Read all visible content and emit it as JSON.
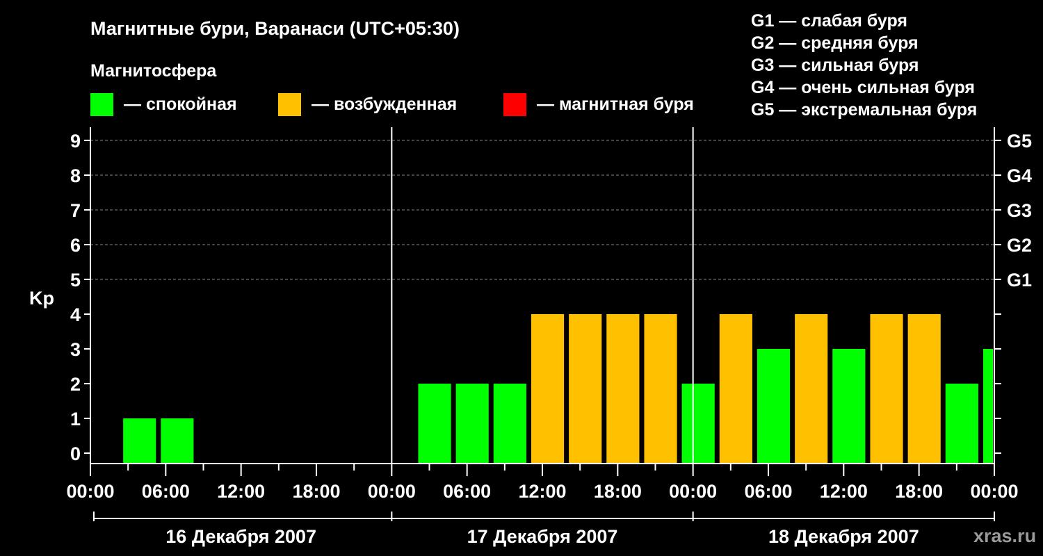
{
  "chart_data": {
    "type": "bar",
    "title": "Магнитные бури, Варанаси (UTC+05:30)",
    "subtitle": "Магнитосфера",
    "ylabel": "Kp",
    "ylim": [
      0,
      9
    ],
    "y_ticks": [
      "0",
      "1",
      "2",
      "3",
      "4",
      "5",
      "6",
      "7",
      "8",
      "9"
    ],
    "right_ticks": [
      {
        "value": 5,
        "label": "G1"
      },
      {
        "value": 6,
        "label": "G2"
      },
      {
        "value": 7,
        "label": "G3"
      },
      {
        "value": 8,
        "label": "G4"
      },
      {
        "value": 9,
        "label": "G5"
      }
    ],
    "x_ticks": [
      "00:00",
      "06:00",
      "12:00",
      "18:00",
      "00:00",
      "06:00",
      "12:00",
      "18:00",
      "00:00",
      "06:00",
      "12:00",
      "18:00",
      "00:00"
    ],
    "dates": [
      "16 Декабря 2007",
      "17 Декабря 2007",
      "18 Декабря 2007"
    ],
    "grid": true,
    "legend_position": "top",
    "status_legend": [
      {
        "label": "— спокойная",
        "color": "#00ff00"
      },
      {
        "label": "— возбужденная",
        "color": "#ffc000"
      },
      {
        "label": "— магнитная буря",
        "color": "#ff0000"
      }
    ],
    "storm_scale": [
      "G1 — слабая буря",
      "G2 — средняя буря",
      "G3 — сильная буря",
      "G4 — очень сильная буря",
      "G5 — экстремальная буря"
    ],
    "series": [
      {
        "values": [
          {
            "start": "16 Декабря 2007 02:30",
            "kp": 1
          },
          {
            "start": "16 Декабря 2007 05:30",
            "kp": 1
          },
          {
            "start": "17 Декабря 2007 02:00",
            "kp": 2
          },
          {
            "start": "17 Декабря 2007 05:00",
            "kp": 2
          },
          {
            "start": "17 Декабря 2007 08:00",
            "kp": 2
          },
          {
            "start": "17 Декабря 2007 11:00",
            "kp": 4
          },
          {
            "start": "17 Декабря 2007 14:00",
            "kp": 4
          },
          {
            "start": "17 Декабря 2007 17:00",
            "kp": 4
          },
          {
            "start": "17 Декабря 2007 20:00",
            "kp": 4
          },
          {
            "start": "17 Декабря 2007 23:00",
            "kp": 2
          },
          {
            "start": "18 Декабря 2007 02:00",
            "kp": 4
          },
          {
            "start": "18 Декабря 2007 05:00",
            "kp": 3
          },
          {
            "start": "18 Декабря 2007 08:00",
            "kp": 4
          },
          {
            "start": "18 Декабря 2007 11:00",
            "kp": 3
          },
          {
            "start": "18 Декабря 2007 14:00",
            "kp": 4
          },
          {
            "start": "18 Декабря 2007 17:00",
            "kp": 4
          },
          {
            "start": "18 Декабря 2007 20:00",
            "kp": 2
          },
          {
            "start": "18 Декабря 2007 23:00",
            "kp": 3
          }
        ]
      }
    ],
    "colors": {
      "calm": "#00ff00",
      "active": "#ffc000",
      "storm": "#ff0000",
      "grid": "#888888"
    }
  },
  "watermark": "xras.ru"
}
